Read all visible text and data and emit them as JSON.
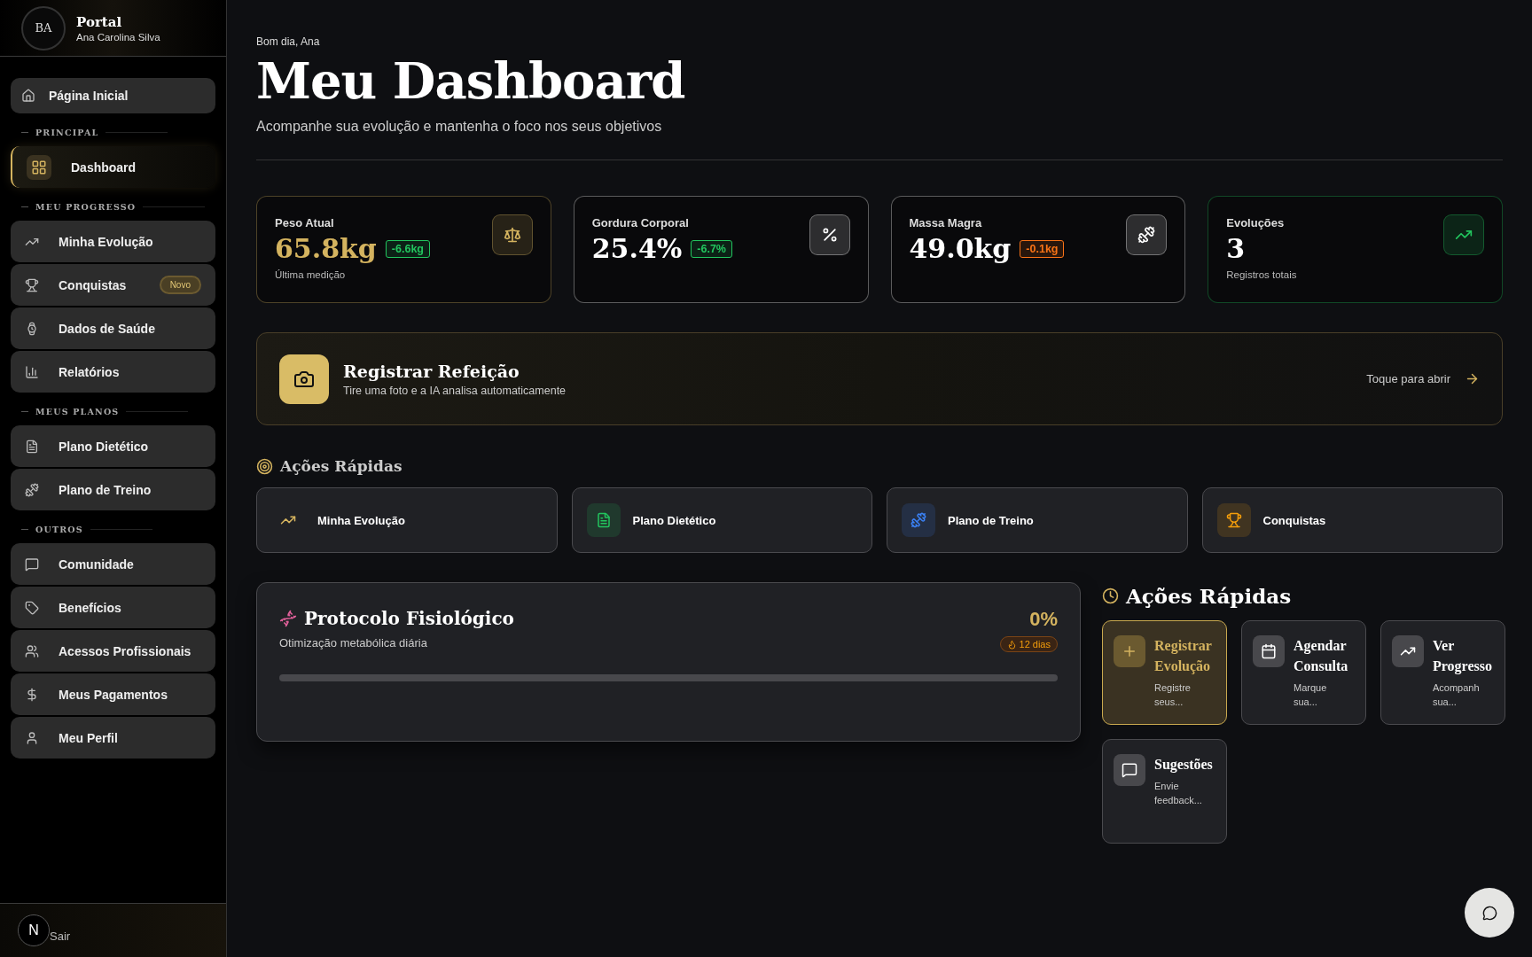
{
  "sidebar": {
    "logo": "BA",
    "title": "Portal",
    "user": "Ana Carolina Silva",
    "home": {
      "label": "Página Inicial",
      "selected": false
    },
    "sections": [
      {
        "title": "PRINCIPAL",
        "items": [
          {
            "label": "Dashboard",
            "selected": true
          }
        ]
      },
      {
        "title": "MEU PROGRESSO",
        "items": [
          {
            "label": "Minha Evolução",
            "selected": false
          },
          {
            "label": "Conquistas",
            "selected": false,
            "badge": "Novo"
          },
          {
            "label": "Dados de Saúde",
            "selected": false
          },
          {
            "label": "Relatórios",
            "selected": false
          }
        ]
      },
      {
        "title": "MEUS PLANOS",
        "items": [
          {
            "label": "Plano Dietético",
            "selected": false
          },
          {
            "label": "Plano de Treino",
            "selected": false
          }
        ]
      },
      {
        "title": "OUTROS",
        "items": [
          {
            "label": "Comunidade",
            "selected": false
          },
          {
            "label": "Benefícios",
            "selected": false
          },
          {
            "label": "Acessos Profissionais",
            "selected": false
          },
          {
            "label": "Meus Pagamentos",
            "selected": false
          },
          {
            "label": "Meu Perfil",
            "selected": false
          }
        ]
      }
    ],
    "footer": {
      "avatar": "N",
      "logout": "Sair"
    }
  },
  "header": {
    "greeting": "Bom dia, Ana",
    "title": "Meu Dashboard",
    "subtitle": "Acompanhe sua evolução e mantenha o foco nos seus objetivos"
  },
  "stats": [
    {
      "label": "Peso Atual",
      "value": "65.8kg",
      "highlighted": true,
      "delta": {
        "text": "-6.6kg",
        "color": "#22c55e"
      },
      "caption": "Última medição",
      "color": "#d4b35f"
    },
    {
      "label": "Gordura Corporal",
      "value": "25.4%",
      "highlighted": false,
      "delta": {
        "text": "-6.7%",
        "color": "#22c55e"
      },
      "color": "#ffffff"
    },
    {
      "label": "Massa Magra",
      "value": "49.0kg",
      "highlighted": false,
      "delta": {
        "text": "-0.1kg",
        "color": "#f97316"
      },
      "color": "#ffffff"
    },
    {
      "label": "Evoluções",
      "value": "3",
      "highlighted": false,
      "caption": "Registros totais",
      "color": "#22c55e"
    }
  ],
  "meal": {
    "title": "Registrar Refeição",
    "subtitle": "Tire uma foto e a IA analisa automaticamente",
    "action": "Toque para abrir"
  },
  "quick_actions": {
    "title": "Ações Rápidas",
    "items": [
      {
        "label": "Minha Evolução",
        "color": "#d4b35f"
      },
      {
        "label": "Plano Dietético",
        "color": "#22c55e"
      },
      {
        "label": "Plano de Treino",
        "color": "#3b82f6"
      },
      {
        "label": "Conquistas",
        "color": "#f59e0b"
      }
    ]
  },
  "protocol": {
    "title": "Protocolo Fisiológico",
    "subtitle": "Otimização metabólica diária",
    "percent": "0%",
    "streak": "12 dias",
    "level": 0
  },
  "shortcuts": {
    "title": "Ações Rápidas",
    "items": [
      {
        "title": "Registrar Evolução",
        "text": "Registre seus...",
        "selected": true
      },
      {
        "title": "Agendar Consulta",
        "text": "Marque sua...",
        "selected": false
      },
      {
        "title": "Ver Progresso",
        "text": "Acompanh sua...",
        "selected": false
      },
      {
        "title": "Sugestões",
        "text": "Envie feedback...",
        "selected": false
      }
    ]
  }
}
